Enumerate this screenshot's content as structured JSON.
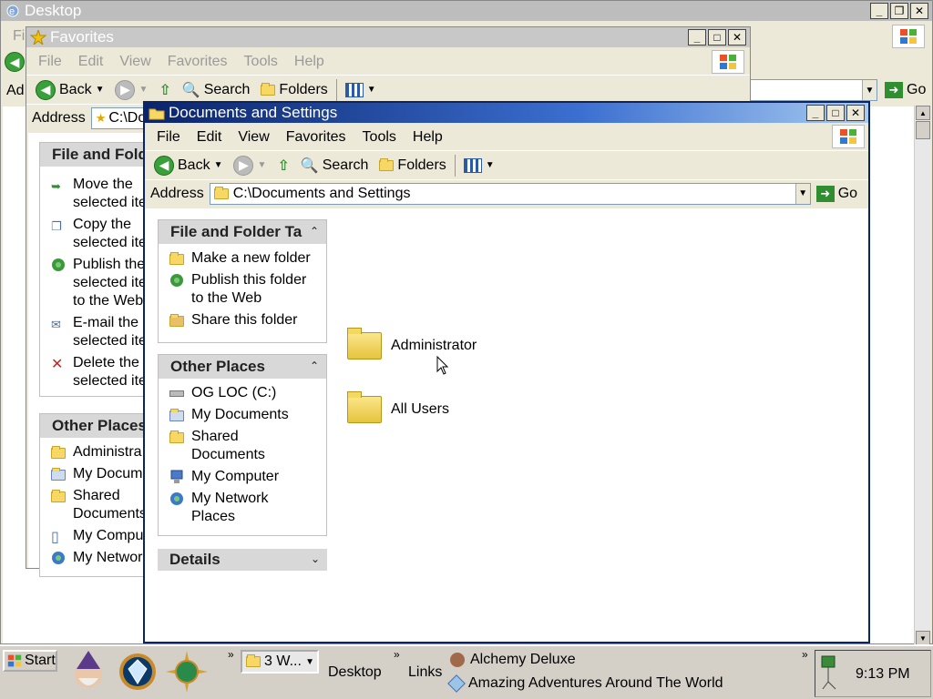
{
  "desktop": {
    "title": "Desktop",
    "menu_partial": "Fil",
    "address_partial": "Ad",
    "go_label": "Go"
  },
  "favorites": {
    "title": "Favorites",
    "menu": [
      "File",
      "Edit",
      "View",
      "Favorites",
      "Tools",
      "Help"
    ],
    "toolbar": {
      "back": "Back",
      "search": "Search",
      "folders": "Folders"
    },
    "address_label": "Address",
    "address_value": "C:\\Do",
    "panel1_title": "File and Fold",
    "panel1_tasks": [
      {
        "line1": "Move the",
        "line2": "selected ite"
      },
      {
        "line1": "Copy the",
        "line2": "selected ite"
      },
      {
        "line1": "Publish the",
        "line2": "selected ite",
        "line3": "to the Web"
      },
      {
        "line1": "E-mail the",
        "line2": "selected ite"
      },
      {
        "line1": "Delete the",
        "line2": "selected ite"
      }
    ],
    "panel2_title": "Other Places",
    "panel2_items": [
      {
        "line1": "Administra"
      },
      {
        "line1": "My Docume"
      },
      {
        "line1": "Shared",
        "line2": "Documents"
      },
      {
        "line1": "My Compu"
      },
      {
        "line1": "My Network"
      }
    ]
  },
  "docs": {
    "title": "Documents and Settings",
    "menu": [
      "File",
      "Edit",
      "View",
      "Favorites",
      "Tools",
      "Help"
    ],
    "toolbar": {
      "back": "Back",
      "search": "Search",
      "folders": "Folders"
    },
    "address_label": "Address",
    "address_value": "C:\\Documents and Settings",
    "go_label": "Go",
    "panels": {
      "tasks_title": "File and Folder Ta",
      "tasks": [
        "Make a new folder",
        "Publish this folder",
        "to the Web",
        "Share this folder"
      ],
      "places_title": "Other Places",
      "places": [
        "OG LOC (C:)",
        "My Documents",
        "Shared",
        "Documents",
        "My Computer",
        "My Network",
        "Places"
      ],
      "details_title": "Details"
    },
    "folders": [
      "Administrator",
      "All Users"
    ]
  },
  "taskbar": {
    "start": "Start",
    "task_button": "3 W...",
    "desktop_label": "Desktop",
    "links_label": "Links",
    "quick_items": [
      "Alchemy Deluxe",
      "Amazing Adventures Around The World"
    ],
    "time": "9:13 PM"
  }
}
